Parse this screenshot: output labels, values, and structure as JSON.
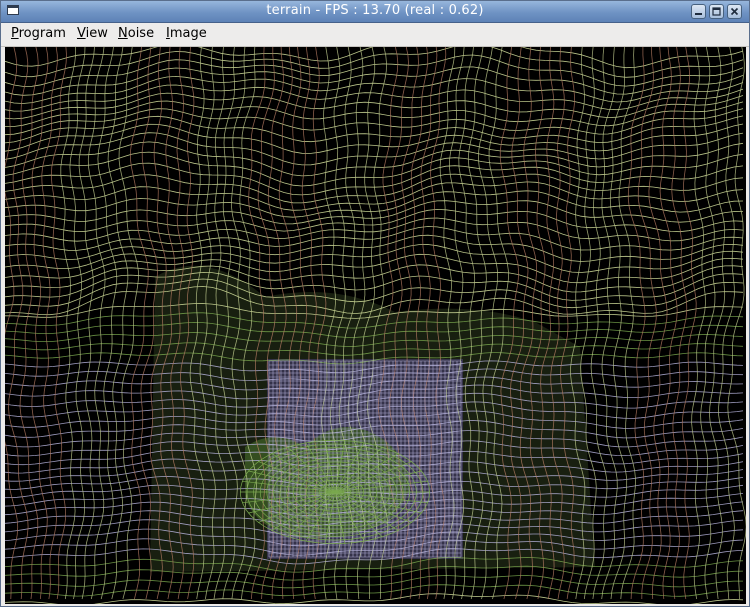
{
  "window": {
    "title": "terrain - FPS : 13.70 (real : 0.62)",
    "app_icon": "window-icon",
    "controls": {
      "minimize_icon": "minimize-icon",
      "maximize_icon": "maximize-icon",
      "close_icon": "close-icon"
    }
  },
  "menubar": {
    "items": [
      {
        "mnemonic": "P",
        "rest": "rogram"
      },
      {
        "mnemonic": "V",
        "rest": "iew"
      },
      {
        "mnemonic": "N",
        "rest": "oise"
      },
      {
        "mnemonic": "I",
        "rest": "mage"
      }
    ]
  },
  "colors": {
    "title_gradient_top": "#97b6dc",
    "title_gradient_bottom": "#5d82b6",
    "menubar_bg": "#edeceb",
    "viewport_bg": "#000000",
    "wire_outer": "#d9e6a0",
    "wire_outer_warm": "#c98a6e",
    "wire_mid_green": "#7aa84e",
    "wire_center_lavender": "#b7b4dd"
  }
}
